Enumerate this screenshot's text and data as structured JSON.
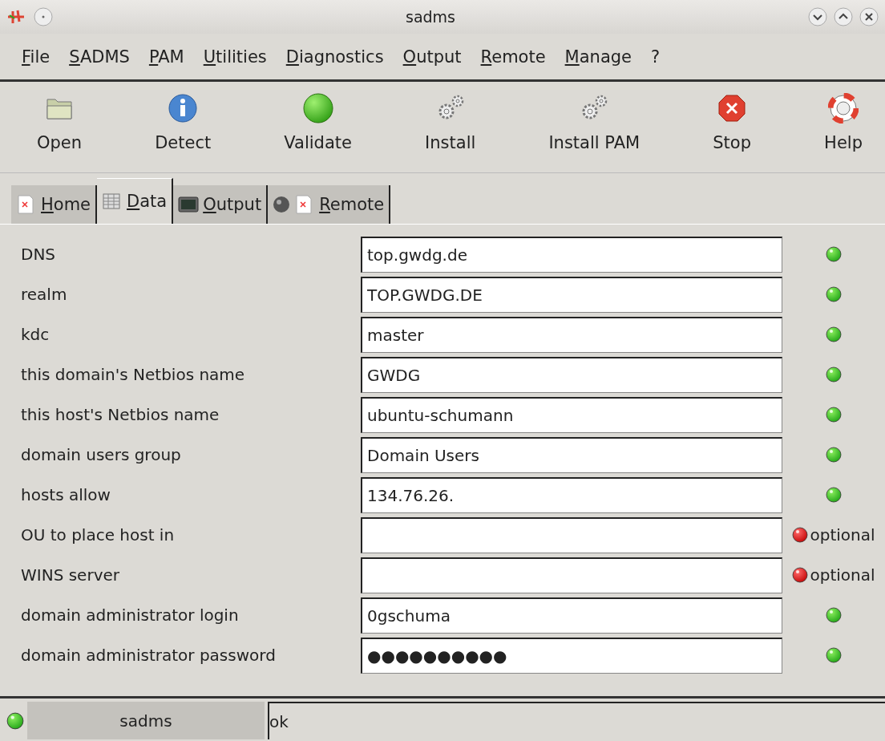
{
  "window": {
    "title": "sadms"
  },
  "menu": [
    {
      "label": "File"
    },
    {
      "label": "SADMS"
    },
    {
      "label": "PAM"
    },
    {
      "label": "Utilities"
    },
    {
      "label": "Diagnostics"
    },
    {
      "label": "Output"
    },
    {
      "label": "Remote"
    },
    {
      "label": "Manage"
    },
    {
      "label": "?"
    }
  ],
  "toolbar": [
    {
      "label": "Open",
      "kind": "folder"
    },
    {
      "label": "Detect",
      "kind": "info"
    },
    {
      "label": "Validate",
      "kind": "ball"
    },
    {
      "label": "Install",
      "kind": "gears"
    },
    {
      "label": "Install PAM",
      "kind": "gears"
    },
    {
      "label": "Stop",
      "kind": "stop"
    },
    {
      "label": "Help",
      "kind": "help"
    }
  ],
  "tabs": [
    {
      "label": "Home",
      "kind": "document",
      "selected": false
    },
    {
      "label": "Data",
      "kind": "table",
      "selected": true
    },
    {
      "label": "Output",
      "kind": "terminal",
      "selected": false
    },
    {
      "label": "Remote",
      "kind": "document",
      "selected": false,
      "indicator": true
    }
  ],
  "fields": [
    {
      "label": "DNS",
      "value": "top.gwdg.de",
      "valid": true
    },
    {
      "label": "realm",
      "value": "TOP.GWDG.DE",
      "valid": true
    },
    {
      "label": "kdc",
      "value": "master",
      "valid": true
    },
    {
      "label": "this domain's Netbios name",
      "value": "GWDG",
      "valid": true
    },
    {
      "label": "this host's Netbios name",
      "value": "ubuntu-schumann",
      "valid": true
    },
    {
      "label": "domain users group",
      "value": "Domain Users",
      "valid": true
    },
    {
      "label": "hosts allow",
      "value": "134.76.26.",
      "valid": true
    },
    {
      "label": "OU to place host in",
      "valid": false,
      "note": "optional"
    },
    {
      "label": "WINS server",
      "valid": false,
      "note": "optional"
    },
    {
      "label": "domain administrator login",
      "value": "0gschuma",
      "valid": true
    },
    {
      "label": "domain administrator password",
      "value": "●●●●●●●●●●",
      "valid": true
    }
  ],
  "status_bar": {
    "valid": true,
    "name": "sadms",
    "message": "ok"
  }
}
